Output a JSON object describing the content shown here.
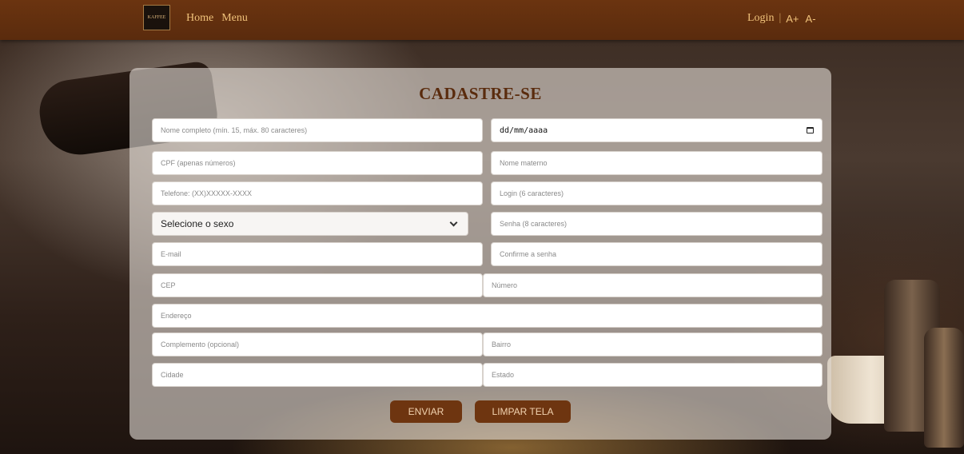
{
  "nav": {
    "logo_text": "KAFFEE",
    "links": [
      "Home",
      "Menu"
    ],
    "login": "Login",
    "separator": "|",
    "font_increase": "A+",
    "font_decrease": "A-"
  },
  "form": {
    "title": "CADASTRE-SE",
    "full_name_placeholder": "Nome completo (mín. 15, máx. 80 caracteres)",
    "birth_date_value": "dd/mm/aaaa",
    "cpf_placeholder": "CPF (apenas números)",
    "mother_name_placeholder": "Nome materno",
    "phone_placeholder": "Telefone: (XX)XXXXX-XXXX",
    "login_placeholder": "Login (6 caracteres)",
    "sex_select_value": "Selecione o sexo",
    "password_placeholder": "Senha (8 caracteres)",
    "email_placeholder": "E-mail",
    "confirm_password_placeholder": "Confirme a senha",
    "cep_placeholder": "CEP",
    "number_placeholder": "Número",
    "address_placeholder": "Endereço",
    "complement_placeholder": "Complemento (opcional)",
    "neighborhood_placeholder": "Bairro",
    "city_placeholder": "Cidade",
    "state_placeholder": "Estado",
    "submit_label": "ENVIAR",
    "clear_label": "LIMPAR TELA"
  },
  "colors": {
    "nav_bg": "#5a2b0d",
    "nav_text": "#f0c27a",
    "accent_button": "#6e3510",
    "title": "#5a2b0d"
  }
}
